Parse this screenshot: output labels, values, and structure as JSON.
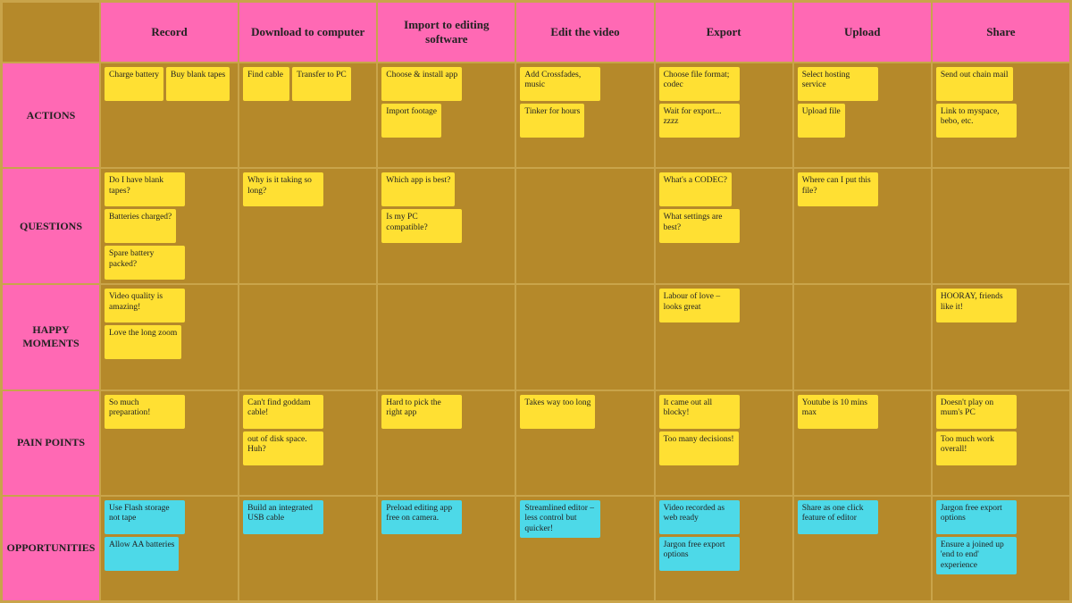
{
  "headers": [
    "Record",
    "Download to computer",
    "Import to editing software",
    "Edit the video",
    "Export",
    "Upload",
    "Share"
  ],
  "rowLabels": [
    "ACTIONS",
    "QUESTIONS",
    "HAPPY MOMENTS",
    "PAIN POINTS",
    "OPPORTUNITIES"
  ],
  "cells": {
    "actions": {
      "record": [
        {
          "text": "Charge battery",
          "color": "yellow"
        },
        {
          "text": "Buy blank tapes",
          "color": "yellow"
        }
      ],
      "download": [
        {
          "text": "Find cable",
          "color": "yellow"
        },
        {
          "text": "Transfer to PC",
          "color": "yellow"
        }
      ],
      "import": [
        {
          "text": "Choose & install app",
          "color": "yellow"
        },
        {
          "text": "Import footage",
          "color": "yellow"
        }
      ],
      "edit": [
        {
          "text": "Add Crossfades, music",
          "color": "yellow"
        },
        {
          "text": "Tinker for hours",
          "color": "yellow"
        }
      ],
      "export": [
        {
          "text": "Choose file format; codec",
          "color": "yellow"
        },
        {
          "text": "Wait for export... zzzz",
          "color": "yellow"
        }
      ],
      "upload": [
        {
          "text": "Select hosting service",
          "color": "yellow"
        },
        {
          "text": "Upload file",
          "color": "yellow"
        }
      ],
      "share": [
        {
          "text": "Send out chain mail",
          "color": "yellow"
        },
        {
          "text": "Link to myspace, bebo, etc.",
          "color": "yellow"
        }
      ]
    },
    "questions": {
      "record": [
        {
          "text": "Do I have blank tapes?",
          "color": "yellow"
        },
        {
          "text": "Batteries charged?",
          "color": "yellow"
        },
        {
          "text": "Spare battery packed?",
          "color": "yellow"
        }
      ],
      "download": [
        {
          "text": "Why is it taking so long?",
          "color": "yellow"
        }
      ],
      "import": [
        {
          "text": "Which app is best?",
          "color": "yellow"
        },
        {
          "text": "Is my PC compatible?",
          "color": "yellow"
        }
      ],
      "edit": [],
      "export": [
        {
          "text": "What's a CODEC?",
          "color": "yellow"
        },
        {
          "text": "What settings are best?",
          "color": "yellow"
        }
      ],
      "upload": [
        {
          "text": "Where can I put this file?",
          "color": "yellow"
        }
      ],
      "share": []
    },
    "happy": {
      "record": [
        {
          "text": "Video quality is amazing!",
          "color": "yellow"
        },
        {
          "text": "Love the long zoom",
          "color": "yellow"
        }
      ],
      "download": [],
      "import": [],
      "edit": [],
      "export": [
        {
          "text": "Labour of love – looks great",
          "color": "yellow"
        }
      ],
      "upload": [],
      "share": [
        {
          "text": "HOORAY, friends like it!",
          "color": "yellow"
        }
      ]
    },
    "pain": {
      "record": [
        {
          "text": "So much preparation!",
          "color": "yellow"
        }
      ],
      "download": [
        {
          "text": "Can't find goddam cable!",
          "color": "yellow"
        },
        {
          "text": "out of disk space. Huh?",
          "color": "yellow"
        }
      ],
      "import": [
        {
          "text": "Hard to pick the right app",
          "color": "yellow"
        }
      ],
      "edit": [
        {
          "text": "Takes way too long",
          "color": "yellow"
        }
      ],
      "export": [
        {
          "text": "It came out all blocky!",
          "color": "yellow"
        },
        {
          "text": "Too many decisions!",
          "color": "yellow"
        }
      ],
      "upload": [
        {
          "text": "Youtube is 10 mins max",
          "color": "yellow"
        }
      ],
      "share": [
        {
          "text": "Doesn't play on mum's PC",
          "color": "yellow"
        },
        {
          "text": "Too much work overall!",
          "color": "yellow"
        }
      ]
    },
    "opportunities": {
      "record": [
        {
          "text": "Use Flash storage not tape",
          "color": "cyan"
        },
        {
          "text": "Allow AA batteries",
          "color": "cyan"
        }
      ],
      "download": [
        {
          "text": "Build an integrated USB cable",
          "color": "cyan"
        }
      ],
      "import": [
        {
          "text": "Preload editing app free on camera.",
          "color": "cyan"
        }
      ],
      "edit": [
        {
          "text": "Streamlined editor – less control but quicker!",
          "color": "cyan"
        }
      ],
      "export": [
        {
          "text": "Video recorded as web ready",
          "color": "cyan"
        },
        {
          "text": "Jargon free export options",
          "color": "cyan"
        }
      ],
      "upload": [
        {
          "text": "Share as one click feature of editor",
          "color": "cyan"
        }
      ],
      "share": [
        {
          "text": "Jargon free export options",
          "color": "cyan"
        },
        {
          "text": "Ensure a joined up 'end to end' experience",
          "color": "cyan"
        }
      ]
    }
  }
}
